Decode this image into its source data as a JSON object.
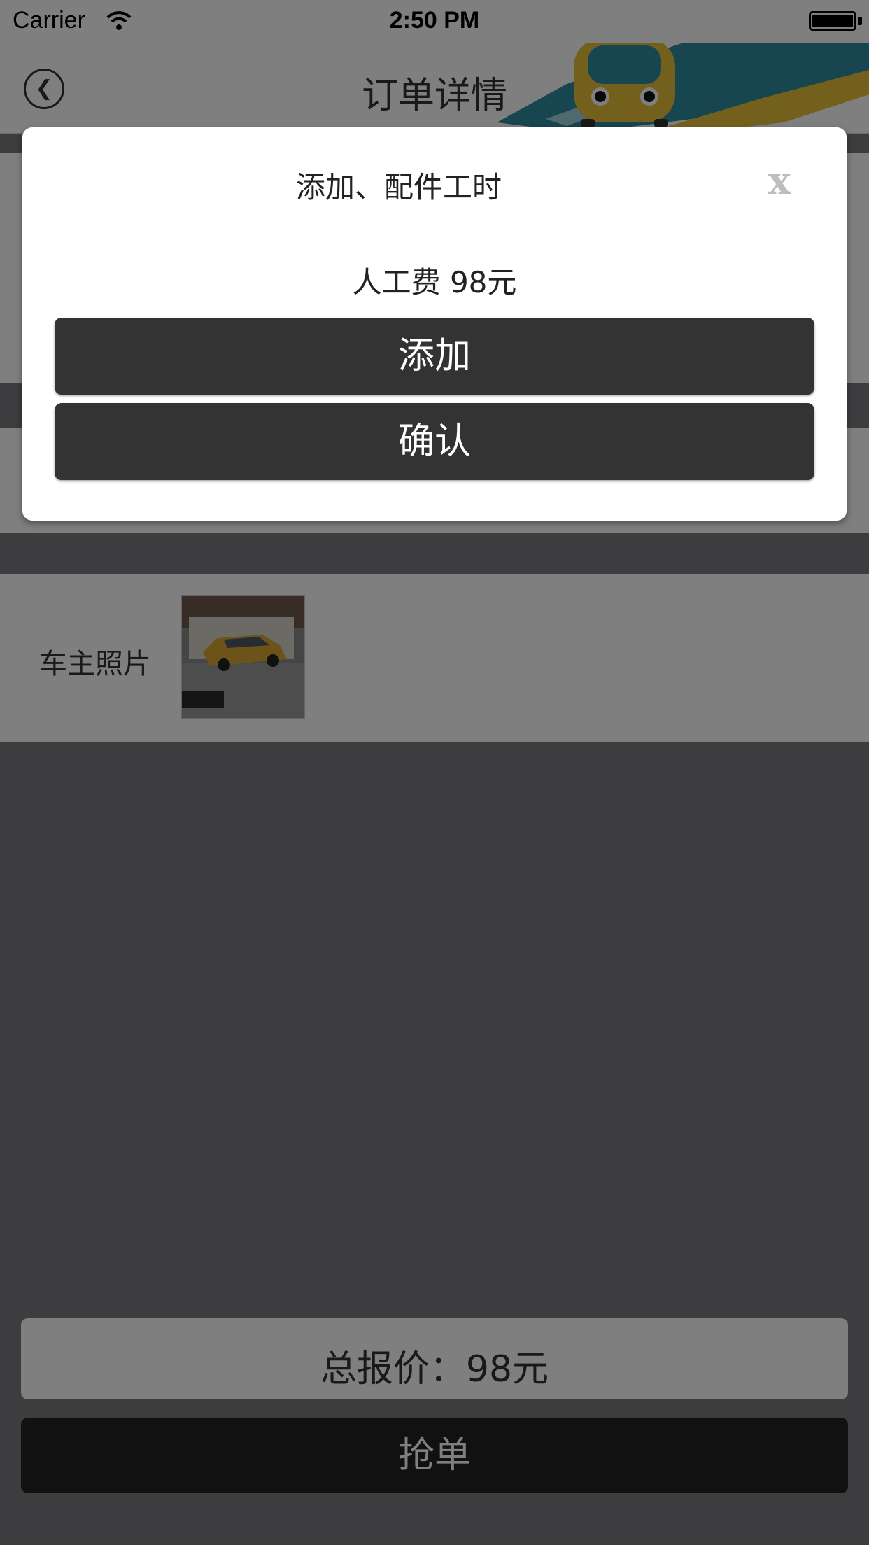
{
  "status_bar": {
    "carrier": "Carrier",
    "time": "2:50 PM"
  },
  "nav": {
    "title": "订单详情"
  },
  "photo_row": {
    "label": "车主照片"
  },
  "footer": {
    "total": "总报价：98元",
    "grab_button": "抢单"
  },
  "modal": {
    "title": "添加、配件工时",
    "close": "x",
    "fee": "人工费 98元",
    "add_button": "添加",
    "confirm_button": "确认"
  },
  "colors": {
    "button_dark": "#333333",
    "grab_button": "#222222",
    "art_teal": "#2f8aa0",
    "art_yellow": "#e8c13a"
  }
}
